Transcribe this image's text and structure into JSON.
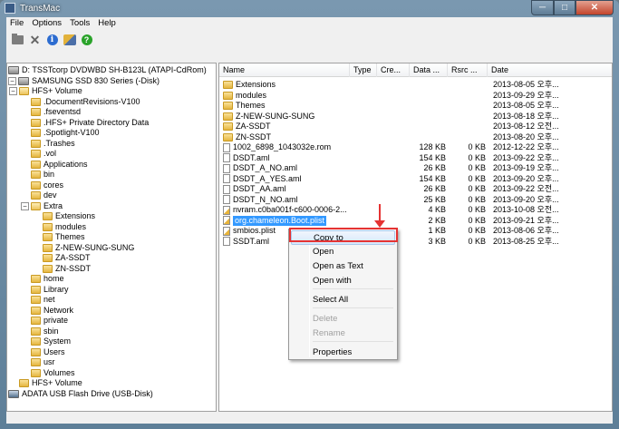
{
  "window": {
    "title": "TransMac"
  },
  "titlebar_buttons": {
    "minimize": "─",
    "maximize": "□",
    "close": "✕"
  },
  "menu": [
    "File",
    "Options",
    "Tools",
    "Help"
  ],
  "toolbar_icons": [
    "folder-icon",
    "close-icon",
    "info-icon",
    "tools-icon",
    "help-icon"
  ],
  "tree": [
    {
      "label": "D: TSSTcorp DVDWBD SH-B123L (ATAPI-CdRom)",
      "type": "drive",
      "depth": 0,
      "expander": ""
    },
    {
      "label": "SAMSUNG SSD 830 Series (-Disk)",
      "type": "drive",
      "depth": 0,
      "expander": "−"
    },
    {
      "label": "HFS+ Volume",
      "type": "folder",
      "depth": 1,
      "expander": "−"
    },
    {
      "label": ".DocumentRevisions-V100",
      "type": "folder",
      "depth": 2,
      "expander": ""
    },
    {
      "label": ".fseventsd",
      "type": "folder",
      "depth": 2,
      "expander": ""
    },
    {
      "label": ".HFS+ Private Directory Data",
      "type": "folder",
      "depth": 2,
      "expander": ""
    },
    {
      "label": ".Spotlight-V100",
      "type": "folder",
      "depth": 2,
      "expander": ""
    },
    {
      "label": ".Trashes",
      "type": "folder",
      "depth": 2,
      "expander": ""
    },
    {
      "label": ".vol",
      "type": "folder",
      "depth": 2,
      "expander": ""
    },
    {
      "label": "Applications",
      "type": "folder",
      "depth": 2,
      "expander": ""
    },
    {
      "label": "bin",
      "type": "folder",
      "depth": 2,
      "expander": ""
    },
    {
      "label": "cores",
      "type": "folder",
      "depth": 2,
      "expander": ""
    },
    {
      "label": "dev",
      "type": "folder",
      "depth": 2,
      "expander": ""
    },
    {
      "label": "Extra",
      "type": "folder",
      "depth": 2,
      "expander": "−"
    },
    {
      "label": "Extensions",
      "type": "folder",
      "depth": 3,
      "expander": ""
    },
    {
      "label": "modules",
      "type": "folder",
      "depth": 3,
      "expander": ""
    },
    {
      "label": "Themes",
      "type": "folder",
      "depth": 3,
      "expander": ""
    },
    {
      "label": "Z-NEW-SUNG-SUNG",
      "type": "folder",
      "depth": 3,
      "expander": ""
    },
    {
      "label": "ZA-SSDT",
      "type": "folder",
      "depth": 3,
      "expander": ""
    },
    {
      "label": "ZN-SSDT",
      "type": "folder",
      "depth": 3,
      "expander": ""
    },
    {
      "label": "home",
      "type": "folder",
      "depth": 2,
      "expander": ""
    },
    {
      "label": "Library",
      "type": "folder",
      "depth": 2,
      "expander": ""
    },
    {
      "label": "net",
      "type": "folder",
      "depth": 2,
      "expander": ""
    },
    {
      "label": "Network",
      "type": "folder",
      "depth": 2,
      "expander": ""
    },
    {
      "label": "private",
      "type": "folder",
      "depth": 2,
      "expander": ""
    },
    {
      "label": "sbin",
      "type": "folder",
      "depth": 2,
      "expander": ""
    },
    {
      "label": "System",
      "type": "folder",
      "depth": 2,
      "expander": ""
    },
    {
      "label": "Users",
      "type": "folder",
      "depth": 2,
      "expander": ""
    },
    {
      "label": "usr",
      "type": "folder",
      "depth": 2,
      "expander": ""
    },
    {
      "label": "Volumes",
      "type": "folder",
      "depth": 2,
      "expander": ""
    },
    {
      "label": "HFS+ Volume",
      "type": "folder",
      "depth": 1,
      "expander": ""
    },
    {
      "label": "ADATA USB Flash Drive (USB-Disk)",
      "type": "usb",
      "depth": 0,
      "expander": ""
    }
  ],
  "columns": [
    "Name",
    "Type",
    "Cre...",
    "Data ...",
    "Rsrc ...",
    "Date"
  ],
  "files": [
    {
      "name": "Extensions",
      "icon": "folder",
      "data": "",
      "rsrc": "",
      "date": "2013-08-05 오후..."
    },
    {
      "name": "modules",
      "icon": "folder",
      "data": "",
      "rsrc": "",
      "date": "2013-09-29 오후..."
    },
    {
      "name": "Themes",
      "icon": "folder",
      "data": "",
      "rsrc": "",
      "date": "2013-08-05 오후..."
    },
    {
      "name": "Z-NEW-SUNG-SUNG",
      "icon": "folder",
      "data": "",
      "rsrc": "",
      "date": "2013-08-18 오후..."
    },
    {
      "name": "ZA-SSDT",
      "icon": "folder",
      "data": "",
      "rsrc": "",
      "date": "2013-08-12 오전..."
    },
    {
      "name": "ZN-SSDT",
      "icon": "folder",
      "data": "",
      "rsrc": "",
      "date": "2013-08-20 오후..."
    },
    {
      "name": "1002_6898_1043032e.rom",
      "icon": "file",
      "data": "128 KB",
      "rsrc": "0 KB",
      "date": "2012-12-22 오후..."
    },
    {
      "name": "DSDT.aml",
      "icon": "file",
      "data": "154 KB",
      "rsrc": "0 KB",
      "date": "2013-09-22 오후..."
    },
    {
      "name": "DSDT_A_NO.aml",
      "icon": "file",
      "data": "26 KB",
      "rsrc": "0 KB",
      "date": "2013-09-19 오후..."
    },
    {
      "name": "DSDT_A_YES.aml",
      "icon": "file",
      "data": "154 KB",
      "rsrc": "0 KB",
      "date": "2013-09-20 오후..."
    },
    {
      "name": "DSDT_AA.aml",
      "icon": "file",
      "data": "26 KB",
      "rsrc": "0 KB",
      "date": "2013-09-22 오전..."
    },
    {
      "name": "DSDT_N_NO.aml",
      "icon": "file",
      "data": "25 KB",
      "rsrc": "0 KB",
      "date": "2013-09-20 오후..."
    },
    {
      "name": "nvram.c0ba001f-c600-0006-2...",
      "icon": "edit",
      "data": "4 KB",
      "rsrc": "0 KB",
      "date": "2013-10-08 오전..."
    },
    {
      "name": "org.chameleon.Boot.plist",
      "icon": "edit",
      "data": "2 KB",
      "rsrc": "0 KB",
      "date": "2013-09-21 오후...",
      "selected": true
    },
    {
      "name": "smbios.plist",
      "icon": "edit",
      "data": "1 KB",
      "rsrc": "0 KB",
      "date": "2013-08-06 오후..."
    },
    {
      "name": "SSDT.aml",
      "icon": "file",
      "data": "3 KB",
      "rsrc": "0 KB",
      "date": "2013-08-25 오후..."
    }
  ],
  "context_menu": [
    {
      "label": "Copy to",
      "enabled": true,
      "highlight": true
    },
    {
      "label": "Open",
      "enabled": true
    },
    {
      "label": "Open as Text",
      "enabled": true
    },
    {
      "label": "Open with",
      "enabled": true
    },
    {
      "sep": true
    },
    {
      "label": "Select All",
      "enabled": true
    },
    {
      "sep": true
    },
    {
      "label": "Delete",
      "enabled": false
    },
    {
      "label": "Rename",
      "enabled": false
    },
    {
      "sep": true
    },
    {
      "label": "Properties",
      "enabled": true
    }
  ],
  "annotation_color": "#e53333"
}
